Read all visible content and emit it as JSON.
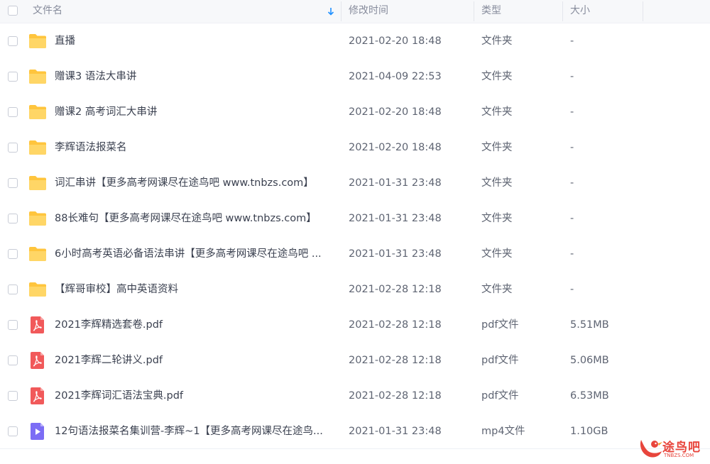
{
  "header": {
    "name": "文件名",
    "time": "修改时间",
    "type": "类型",
    "size": "大小"
  },
  "colors": {
    "folder": "#ffc53d",
    "pdf": "#f1595a",
    "video": "#7c6df5",
    "sort_arrow": "#1e90ff",
    "watermark": "#e8453c"
  },
  "rows": [
    {
      "icon": "folder-icon",
      "name": "直播",
      "time": "2021-02-20 18:48",
      "type": "文件夹",
      "size": "-"
    },
    {
      "icon": "folder-icon",
      "name": "赠课3 语法大串讲",
      "time": "2021-04-09 22:53",
      "type": "文件夹",
      "size": "-"
    },
    {
      "icon": "folder-icon",
      "name": "赠课2  高考词汇大串讲",
      "time": "2021-02-20 18:48",
      "type": "文件夹",
      "size": "-"
    },
    {
      "icon": "folder-icon",
      "name": "李辉语法报菜名",
      "time": "2021-02-20 18:48",
      "type": "文件夹",
      "size": "-"
    },
    {
      "icon": "folder-icon",
      "name": "词汇串讲【更多高考网课尽在途鸟吧 www.tnbzs.com】",
      "time": "2021-01-31 23:48",
      "type": "文件夹",
      "size": "-"
    },
    {
      "icon": "folder-icon",
      "name": "88长难句【更多高考网课尽在途鸟吧 www.tnbzs.com】",
      "time": "2021-01-31 23:48",
      "type": "文件夹",
      "size": "-"
    },
    {
      "icon": "folder-icon",
      "name": "6小时高考英语必备语法串讲【更多高考网课尽在途鸟吧 ...",
      "time": "2021-01-31 23:48",
      "type": "文件夹",
      "size": "-"
    },
    {
      "icon": "folder-icon",
      "name": "【辉哥审校】高中英语资料",
      "time": "2021-02-28 12:18",
      "type": "文件夹",
      "size": "-"
    },
    {
      "icon": "pdf-icon",
      "name": "2021李辉精选套卷.pdf",
      "time": "2021-02-28 12:18",
      "type": "pdf文件",
      "size": "5.51MB"
    },
    {
      "icon": "pdf-icon",
      "name": "2021李辉二轮讲义.pdf",
      "time": "2021-02-28 12:18",
      "type": "pdf文件",
      "size": "5.06MB"
    },
    {
      "icon": "pdf-icon",
      "name": "2021李辉词汇语法宝典.pdf",
      "time": "2021-02-28 12:18",
      "type": "pdf文件",
      "size": "6.53MB"
    },
    {
      "icon": "video-icon",
      "name": "12句语法报菜名集训营-李辉~1【更多高考网课尽在途鸟...",
      "time": "2021-01-31 23:48",
      "type": "mp4文件",
      "size": "1.10GB"
    }
  ],
  "watermark": {
    "text": "途鸟吧",
    "sub": "TNBZS.COM"
  }
}
